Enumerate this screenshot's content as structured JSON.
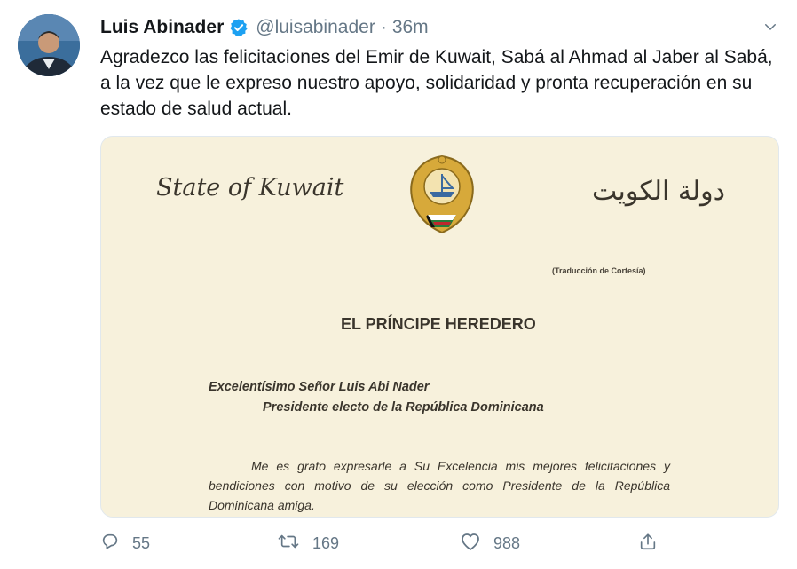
{
  "user": {
    "name": "Luis Abinader",
    "handle": "@luisabinader",
    "separator": "·",
    "time": "36m"
  },
  "tweet": {
    "text": "Agradezco las felicitaciones del Emir de Kuwait, Sabá al Ahmad al Jaber al Sabá, a la vez que le expreso nuestro apoyo, solidaridad y pronta recuperación en su estado de salud actual."
  },
  "letter": {
    "state_en": "State of Kuwait",
    "state_ar": "دولة الكويت",
    "courtesy": "(Traducción de Cortesía)",
    "title": "EL PRÍNCIPE HEREDERO",
    "addressee_line1": "Excelentísimo Señor Luis Abi Nader",
    "addressee_line2": "Presidente electo de la República Dominicana",
    "body": "Me es grato expresarle a Su Excelencia mis mejores felicitaciones y bendiciones con motivo de su elección como Presidente de la República Dominicana amiga."
  },
  "actions": {
    "reply_count": "55",
    "retweet_count": "169",
    "like_count": "988"
  },
  "icons": {
    "verified": "verified-badge-icon",
    "caret": "chevron-down-icon",
    "reply": "reply-icon",
    "retweet": "retweet-icon",
    "like": "heart-icon",
    "share": "share-icon"
  },
  "colors": {
    "accent": "#1da1f2",
    "muted": "#657786",
    "text": "#14171a",
    "paper": "#f7f1dc"
  }
}
